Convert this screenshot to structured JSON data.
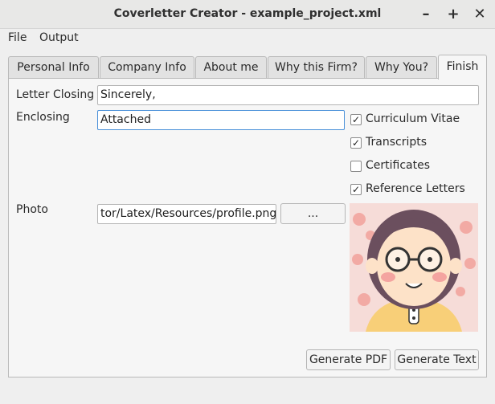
{
  "window": {
    "title": "Coverletter Creator - example_project.xml",
    "minimize_icon": "minimize-icon",
    "maximize_icon": "maximize-icon",
    "close_icon": "close-icon"
  },
  "menubar": {
    "items": [
      {
        "label": "File"
      },
      {
        "label": "Output"
      }
    ]
  },
  "tabs": [
    {
      "label": "Personal Info",
      "active": false
    },
    {
      "label": "Company Info",
      "active": false
    },
    {
      "label": "About me",
      "active": false
    },
    {
      "label": "Why this Firm?",
      "active": false
    },
    {
      "label": "Why You?",
      "active": false
    },
    {
      "label": "Finish",
      "active": true
    }
  ],
  "finish": {
    "letter_closing_label": "Letter Closing",
    "letter_closing_value": "Sincerely,",
    "enclosing_label": "Enclosing",
    "enclosing_value": "Attached",
    "checkboxes": [
      {
        "label": "Curriculum Vitae",
        "checked": true
      },
      {
        "label": "Transcripts",
        "checked": true
      },
      {
        "label": "Certificates",
        "checked": false
      },
      {
        "label": "Reference Letters",
        "checked": true
      }
    ],
    "photo_label": "Photo",
    "photo_path": "tor/Latex/Resources/profile.png",
    "browse_label": "...",
    "generate_pdf_label": "Generate PDF",
    "generate_text_label": "Generate Text"
  },
  "colors": {
    "focus_border": "#4a90d9",
    "photo_bg": "#f6dcd8"
  }
}
